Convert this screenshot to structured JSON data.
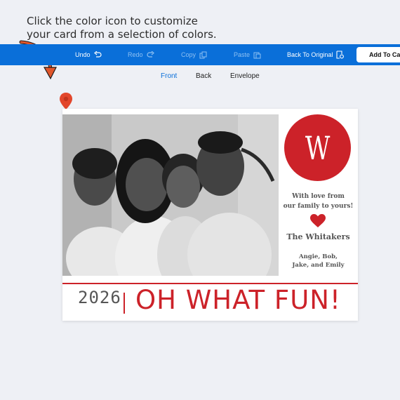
{
  "hint": {
    "line1": "Click the color icon to customize",
    "line2": "your card from a selection of colors."
  },
  "toolbar": {
    "undo": "Undo",
    "redo": "Redo",
    "copy": "Copy",
    "paste": "Paste",
    "back_to_original": "Back To Original",
    "add_to_cart": "Add To Ca"
  },
  "views": {
    "front": "Front",
    "back": "Back",
    "envelope": "Envelope"
  },
  "card": {
    "monogram": "W",
    "message_line1": "With love from",
    "message_line2": "our family to yours!",
    "family_name": "The Whitakers",
    "names_line1": "Angie, Bob,",
    "names_line2": "Jake, and Emily",
    "year": "2026",
    "headline": "OH WHAT FUN!",
    "accent_color": "#cc2229"
  },
  "colors": {
    "toolbar": "#0a6fd9",
    "background": "#eef0f5",
    "pointer_arrow": "#e0562b"
  }
}
